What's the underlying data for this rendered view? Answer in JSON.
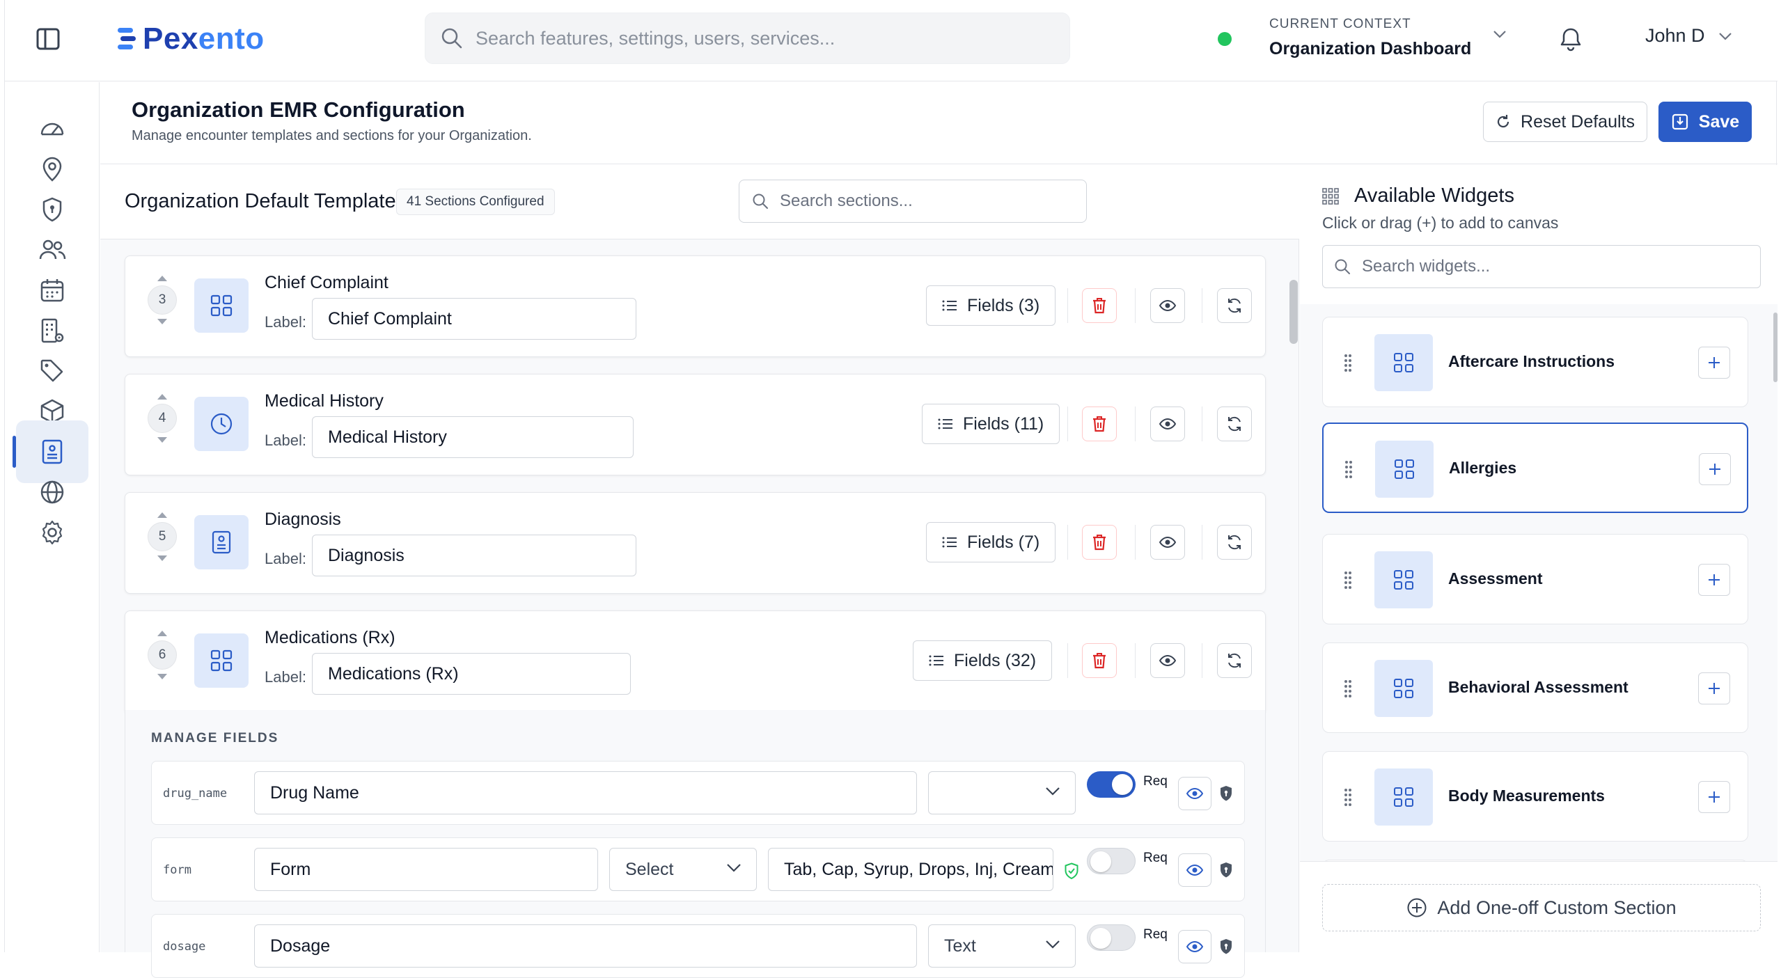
{
  "app": {
    "logo": "Pexento",
    "logo_part1": "Pex",
    "logo_part2": "ento"
  },
  "search": {
    "placeholder": "Search features, settings, users, services..."
  },
  "context": {
    "label": "CURRENT CONTEXT",
    "value": "Organization Dashboard",
    "status_color": "#22c55e"
  },
  "user": {
    "name": "John D"
  },
  "sidebar": {
    "items": [
      {
        "icon": "dashboard-gauge-icon"
      },
      {
        "icon": "location-pin-icon"
      },
      {
        "icon": "shield-icon"
      },
      {
        "icon": "users-icon"
      },
      {
        "icon": "calendar-icon"
      },
      {
        "icon": "building-settings-icon"
      },
      {
        "icon": "tags-icon"
      },
      {
        "icon": "box-icon"
      },
      {
        "icon": "medical-record-icon",
        "active": true
      },
      {
        "icon": "globe-icon"
      },
      {
        "icon": "gear-icon"
      }
    ]
  },
  "header": {
    "title": "Organization EMR Configuration",
    "subtitle": "Manage encounter templates and sections for your Organization.",
    "reset_label": "Reset Defaults",
    "save_label": "Save",
    "accent": "#2b5cc7"
  },
  "canvas": {
    "template_title": "Organization Default Template",
    "sections_badge": "41 Sections Configured",
    "search_placeholder": "Search sections...",
    "label_tag": "Label:",
    "sections": [
      {
        "order": "3",
        "name": "Chief Complaint",
        "label": "Chief Complaint",
        "fields": "Fields (3)",
        "icon": "grid-icon"
      },
      {
        "order": "4",
        "name": "Medical History",
        "label": "Medical History",
        "fields": "Fields (11)",
        "icon": "clock-icon"
      },
      {
        "order": "5",
        "name": "Diagnosis",
        "label": "Diagnosis",
        "fields": "Fields (7)",
        "icon": "id-badge-icon"
      },
      {
        "order": "6",
        "name": "Medications (Rx)",
        "label": "Medications (Rx)",
        "fields": "Fields (32)",
        "icon": "grid-icon"
      }
    ],
    "manage_fields": {
      "title": "MANAGE FIELDS",
      "req_label": "Req",
      "rows": [
        {
          "key": "drug_name",
          "label": "Drug Name",
          "type": "",
          "required": true
        },
        {
          "key": "form",
          "label": "Form",
          "type": "Select",
          "options": "Tab, Cap, Syrup, Drops, Inj, Cream, Oint",
          "required": false
        },
        {
          "key": "dosage",
          "label": "Dosage",
          "type": "Text",
          "required": false
        }
      ]
    }
  },
  "widgets": {
    "title": "Available Widgets",
    "subtitle": "Click or drag (+) to add to canvas",
    "search_placeholder": "Search widgets...",
    "items": [
      {
        "name": "Aftercare Instructions",
        "selected": false
      },
      {
        "name": "Allergies",
        "selected": true
      },
      {
        "name": "Assessment",
        "selected": false
      },
      {
        "name": "Behavioral Assessment",
        "selected": false
      },
      {
        "name": "Body Measurements",
        "selected": false
      }
    ],
    "add_custom_label": "Add One-off Custom Section"
  }
}
